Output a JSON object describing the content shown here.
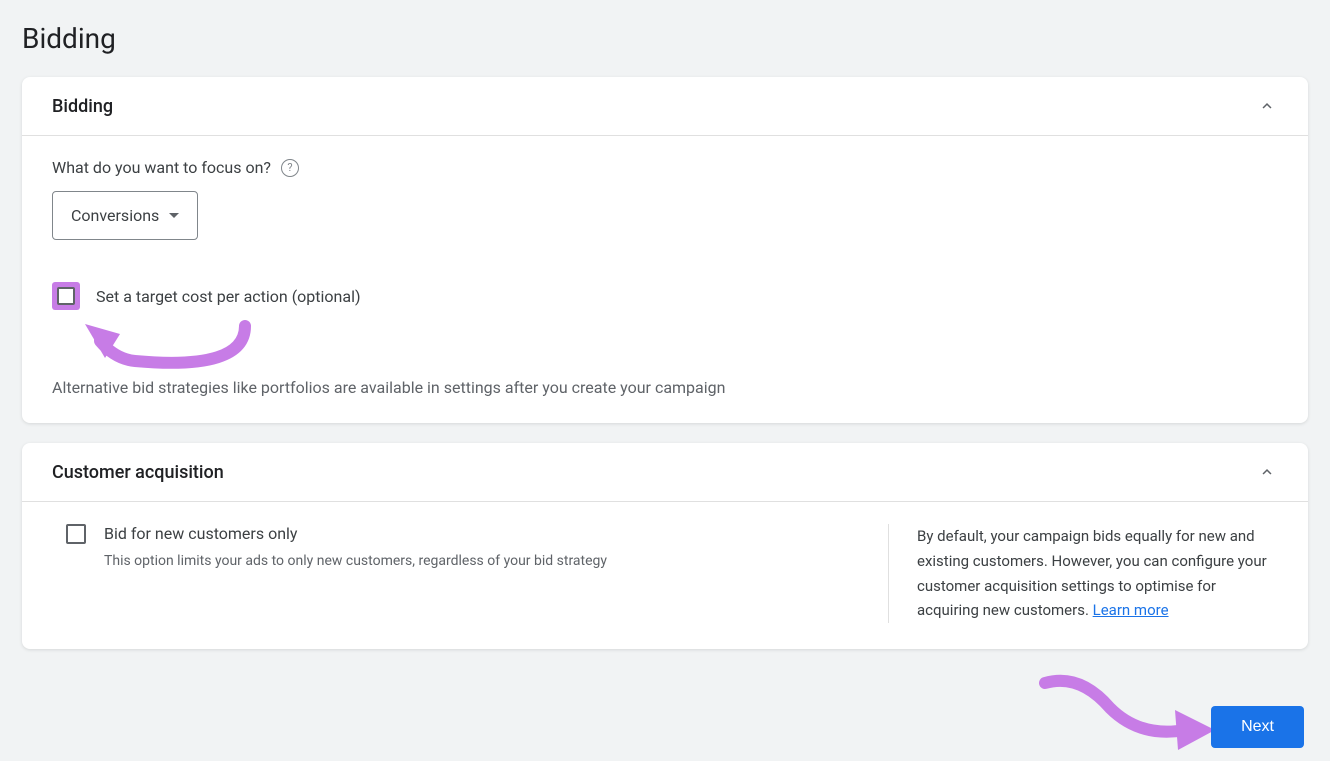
{
  "page": {
    "title": "Bidding"
  },
  "bidding_card": {
    "title": "Bidding",
    "focus_label": "What do you want to focus on?",
    "dropdown_value": "Conversions",
    "target_cpa_label": "Set a target cost per action (optional)",
    "alt_strategies_text": "Alternative bid strategies like portfolios are available in settings after you create your campaign"
  },
  "customer_card": {
    "title": "Customer acquisition",
    "checkbox_label": "Bid for new customers only",
    "checkbox_subtext": "This option limits your ads to only new customers, regardless of your bid strategy",
    "info_text": "By default, your campaign bids equally for new and existing customers. However, you can configure your customer acquisition settings to optimise for acquiring new customers. ",
    "learn_more": "Learn more"
  },
  "buttons": {
    "next": "Next"
  }
}
